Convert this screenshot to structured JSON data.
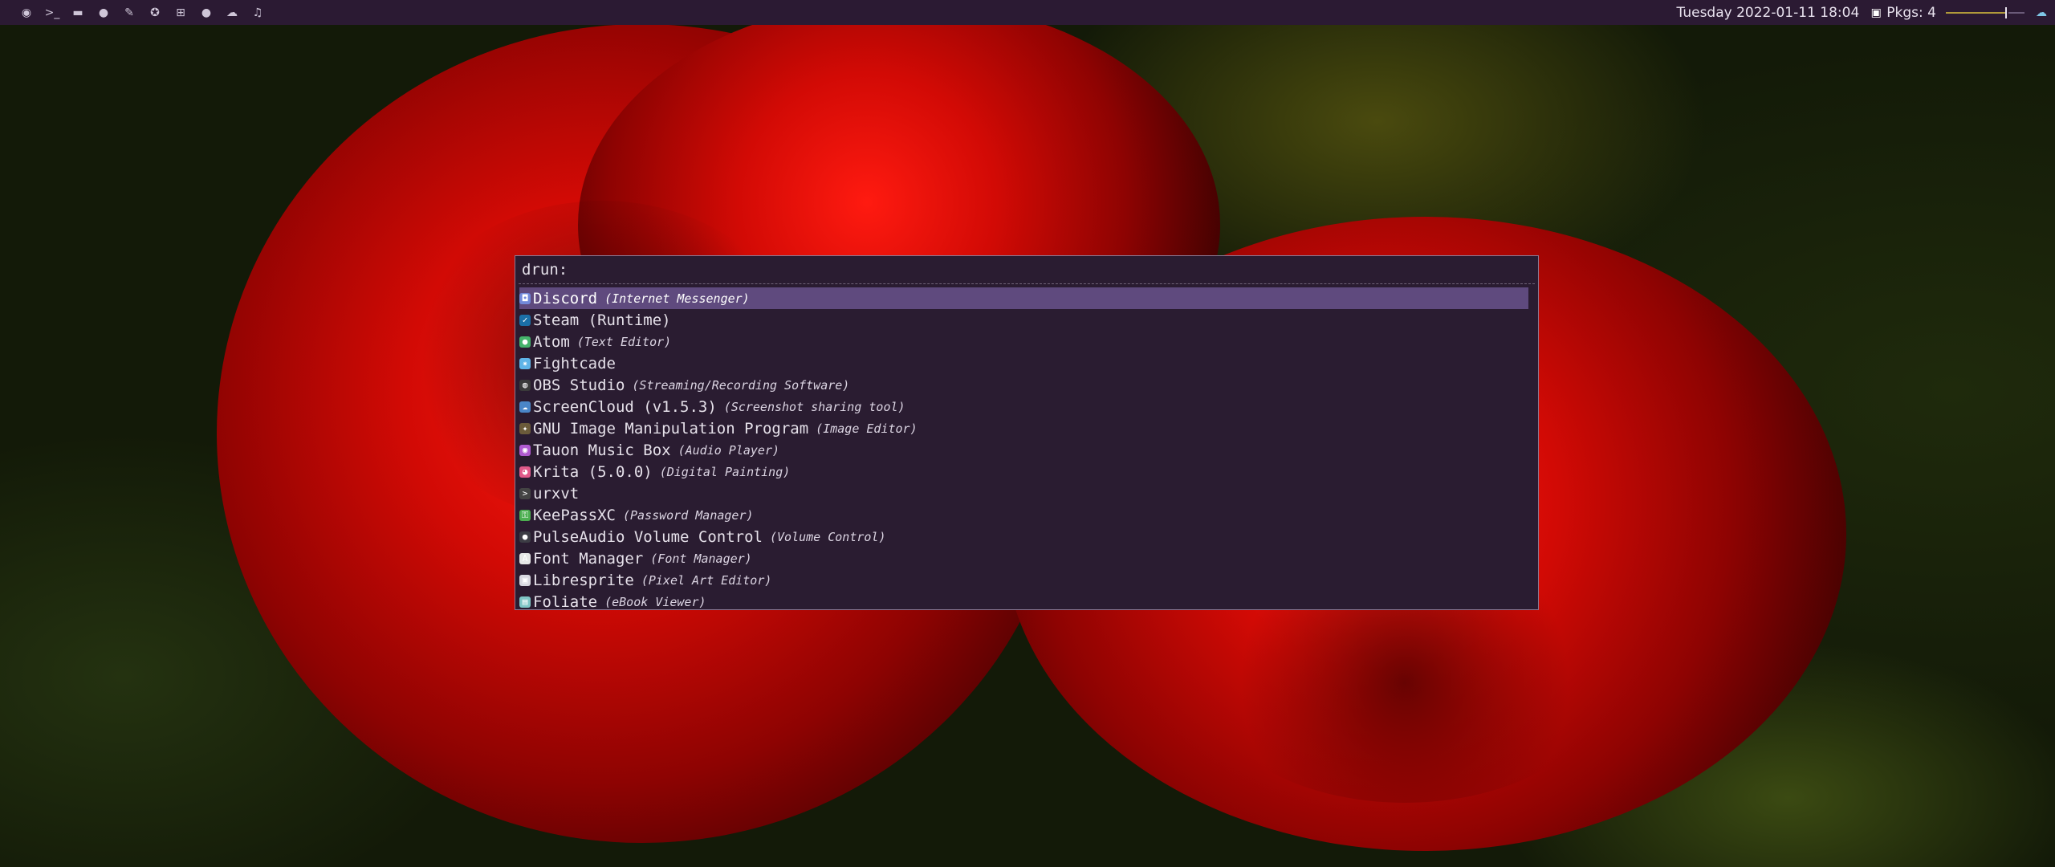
{
  "wallpaper": {
    "description_colors": {
      "accent": "#d20a05",
      "background": "#131a08"
    }
  },
  "topbar": {
    "left_icons": [
      {
        "name": "arch-logo-icon",
        "glyph": "◉"
      },
      {
        "name": "terminal-icon",
        "glyph": ">_"
      },
      {
        "name": "folder-icon",
        "glyph": "▬"
      },
      {
        "name": "github-icon",
        "glyph": "●"
      },
      {
        "name": "pen-icon",
        "glyph": "✎"
      },
      {
        "name": "steam-icon",
        "glyph": "✪"
      },
      {
        "name": "gamepad-icon",
        "glyph": "⊞"
      },
      {
        "name": "chat-icon",
        "glyph": "●"
      },
      {
        "name": "soundcloud-icon",
        "glyph": "☁"
      },
      {
        "name": "music-icon",
        "glyph": "♫"
      }
    ],
    "datetime": "Tuesday 2022-01-11 18:04",
    "pkgs_icon": "package-icon",
    "pkgs_label": "Pkgs: 4",
    "volume_level": 0.75,
    "tray_icon": "network-icon",
    "colors": {
      "bar": "#2b1a33",
      "text": "#e8e2ee",
      "volume": "#b09a3a"
    }
  },
  "launcher": {
    "prompt": "drun:",
    "selected_index": 0,
    "colors": {
      "background": "#2a1c31",
      "selected": "#5f4a7e",
      "border": "#8a7a95"
    },
    "entries": [
      {
        "name": "Discord",
        "generic": "(Internet Messenger)",
        "icon": "discord-icon",
        "icon_color": "#7289da",
        "glyph": "◘"
      },
      {
        "name": "Steam (Runtime)",
        "generic": "",
        "icon": "steam-icon",
        "icon_color": "#1b6fa8",
        "glyph": "✓"
      },
      {
        "name": "Atom",
        "generic": "(Text Editor)",
        "icon": "atom-icon",
        "icon_color": "#45b36b",
        "glyph": "●"
      },
      {
        "name": "Fightcade",
        "generic": "",
        "icon": "fightcade-icon",
        "icon_color": "#5fb4e8",
        "glyph": "✷"
      },
      {
        "name": "OBS Studio",
        "generic": "(Streaming/Recording Software)",
        "icon": "obs-icon",
        "icon_color": "#3a3a3a",
        "glyph": "◍"
      },
      {
        "name": "ScreenCloud (v1.5.3)",
        "generic": "(Screenshot sharing tool)",
        "icon": "screencloud-icon",
        "icon_color": "#4a86c8",
        "glyph": "☁"
      },
      {
        "name": "GNU Image Manipulation Program",
        "generic": "(Image Editor)",
        "icon": "gimp-icon",
        "icon_color": "#6b5a3a",
        "glyph": "✦"
      },
      {
        "name": "Tauon Music Box",
        "generic": "(Audio Player)",
        "icon": "tauon-icon",
        "icon_color": "#b05ad0",
        "glyph": "◉"
      },
      {
        "name": "Krita (5.0.0)",
        "generic": "(Digital Painting)",
        "icon": "krita-icon",
        "icon_color": "#e05a8a",
        "glyph": "◕"
      },
      {
        "name": "urxvt",
        "generic": "",
        "icon": "terminal-icon",
        "icon_color": "#444444",
        "glyph": ">"
      },
      {
        "name": "KeePassXC",
        "generic": "(Password Manager)",
        "icon": "keepassxc-icon",
        "icon_color": "#4caf50",
        "glyph": "⚿"
      },
      {
        "name": "PulseAudio Volume Control",
        "generic": "(Volume Control)",
        "icon": "pulseaudio-icon",
        "icon_color": "#3c3c44",
        "glyph": "●"
      },
      {
        "name": "Font Manager",
        "generic": "(Font Manager)",
        "icon": "font-manager-icon",
        "icon_color": "#e6e6e6",
        "glyph": "A"
      },
      {
        "name": "Libresprite",
        "generic": "(Pixel Art Editor)",
        "icon": "libresprite-icon",
        "icon_color": "#d8d8e0",
        "glyph": "▣"
      },
      {
        "name": "Foliate",
        "generic": "(eBook Viewer)",
        "icon": "foliate-icon",
        "icon_color": "#7fc6c6",
        "glyph": "▤"
      }
    ]
  }
}
